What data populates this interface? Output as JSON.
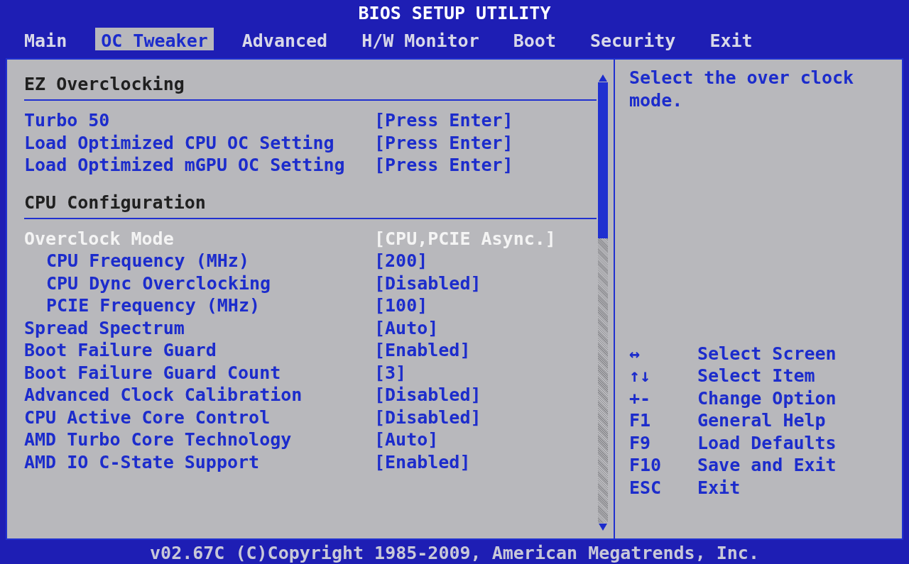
{
  "title": "BIOS SETUP UTILITY",
  "tabs": [
    {
      "label": "Main",
      "selected": false
    },
    {
      "label": "OC Tweaker",
      "selected": true
    },
    {
      "label": "Advanced",
      "selected": false
    },
    {
      "label": "H/W Monitor",
      "selected": false
    },
    {
      "label": "Boot",
      "selected": false
    },
    {
      "label": "Security",
      "selected": false
    },
    {
      "label": "Exit",
      "selected": false
    }
  ],
  "sections": [
    {
      "title": "EZ Overclocking",
      "items": [
        {
          "label": "Turbo 50",
          "value": "[Press Enter]",
          "selected": false
        },
        {
          "label": "Load Optimized CPU OC Setting",
          "value": "[Press Enter]",
          "selected": false
        },
        {
          "label": "Load Optimized mGPU OC Setting",
          "value": "[Press Enter]",
          "selected": false
        }
      ]
    },
    {
      "title": "CPU Configuration",
      "items": [
        {
          "label": "Overclock Mode",
          "value": "[CPU,PCIE Async.]",
          "selected": true,
          "children": [
            {
              "label": "CPU Frequency (MHz)",
              "value": "[200]",
              "selected": false
            },
            {
              "label": "CPU Dync Overclocking",
              "value": "[Disabled]",
              "selected": false
            },
            {
              "label": "PCIE Frequency (MHz)",
              "value": "[100]",
              "selected": false
            }
          ]
        },
        {
          "label": "Spread Spectrum",
          "value": "[Auto]",
          "selected": false
        },
        {
          "label": "Boot Failure Guard",
          "value": "[Enabled]",
          "selected": false
        },
        {
          "label": "Boot Failure Guard Count",
          "value": "[3]",
          "selected": false
        },
        {
          "label": "Advanced Clock Calibration",
          "value": "[Disabled]",
          "selected": false
        },
        {
          "label": "CPU Active Core Control",
          "value": "[Disabled]",
          "selected": false
        },
        {
          "label": "AMD Turbo Core Technology",
          "value": "[Auto]",
          "selected": false
        },
        {
          "label": "AMD IO C-State Support",
          "value": "[Enabled]",
          "selected": false
        }
      ]
    }
  ],
  "help": "Select the over clock mode.",
  "keys": [
    {
      "key": "↔",
      "action": "Select Screen"
    },
    {
      "key": "↑↓",
      "action": "Select Item"
    },
    {
      "key": "+-",
      "action": "Change Option"
    },
    {
      "key": "F1",
      "action": "General Help"
    },
    {
      "key": "F9",
      "action": "Load Defaults"
    },
    {
      "key": "F10",
      "action": "Save and Exit"
    },
    {
      "key": "ESC",
      "action": "Exit"
    }
  ],
  "footer": "v02.67C (C)Copyright 1985-2009, American Megatrends, Inc."
}
